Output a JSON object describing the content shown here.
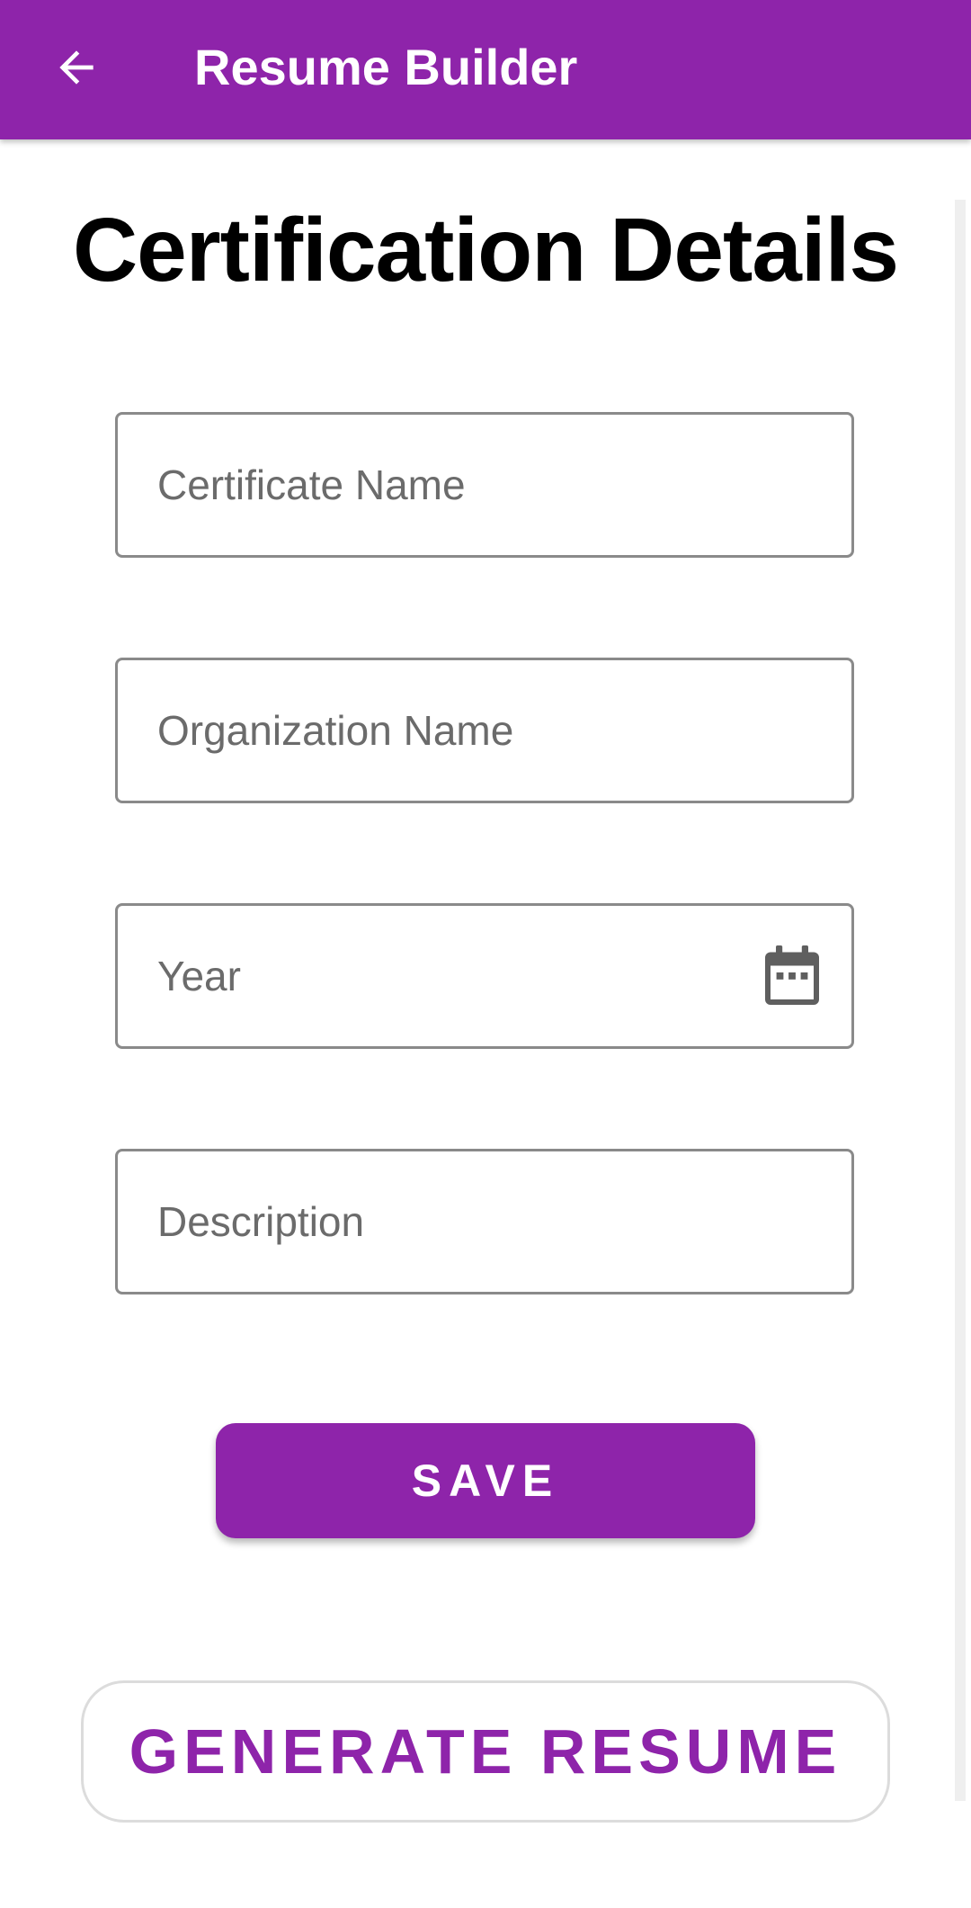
{
  "app_bar": {
    "title": "Resume Builder",
    "back_icon": "arrow-left-icon",
    "color": "#8e24aa"
  },
  "page": {
    "title": "Certification Details"
  },
  "form": {
    "certificate_name": {
      "placeholder": "Certificate Name",
      "value": ""
    },
    "organization_name": {
      "placeholder": "Organization Name",
      "value": ""
    },
    "year": {
      "placeholder": "Year",
      "value": "",
      "icon": "calendar-icon"
    },
    "description": {
      "placeholder": "Description",
      "value": ""
    }
  },
  "actions": {
    "save_label": "SAVE",
    "generate_label": "GENERATE RESUME"
  },
  "colors": {
    "accent": "#8e24aa",
    "field_border": "#8a8a8a",
    "placeholder": "#6b6b6b"
  }
}
